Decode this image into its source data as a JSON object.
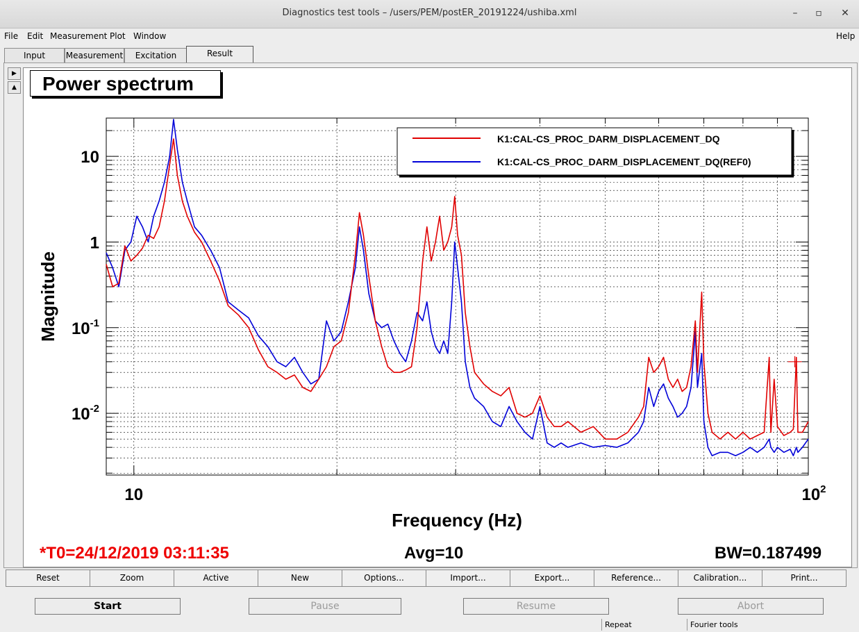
{
  "window": {
    "title": "Diagnostics test tools – /users/PEM/postER_20191224/ushiba.xml"
  },
  "menu": {
    "file": "File",
    "edit": "Edit",
    "measurement": "Measurement",
    "plot": "Plot",
    "window": "Window",
    "help": "Help"
  },
  "tabs": [
    "Input",
    "Measurement",
    "Excitation",
    "Result"
  ],
  "active_tab": "Result",
  "plot": {
    "title": "Power spectrum",
    "status_left": "*T0=24/12/2019 03:11:35",
    "status_mid": "Avg=10",
    "status_right": "BW=0.187499"
  },
  "chart_data": {
    "type": "line",
    "xlabel": "Frequency (Hz)",
    "ylabel": "Magnitude",
    "xscale": "log",
    "yscale": "log",
    "xlim": [
      9.1,
      100
    ],
    "ylim": [
      0.0019,
      28
    ],
    "x_tick_labels": [
      "10",
      "10^2"
    ],
    "y_tick_labels": [
      "10^-2",
      "10^-1",
      "1",
      "10"
    ],
    "grid": true,
    "legend_position": "top-right",
    "legend": [
      {
        "name": "K1:CAL-CS_PROC_DARM_DISPLACEMENT_DQ",
        "color": "#e00000"
      },
      {
        "name": "K1:CAL-CS_PROC_DARM_DISPLACEMENT_DQ(REF0)",
        "color": "#0000d8"
      }
    ],
    "series": [
      {
        "name": "K1:CAL-CS_PROC_DARM_DISPLACEMENT_DQ",
        "color": "#e00000",
        "points": [
          [
            9.1,
            0.55
          ],
          [
            9.3,
            0.3
          ],
          [
            9.5,
            0.33
          ],
          [
            9.7,
            0.9
          ],
          [
            9.9,
            0.6
          ],
          [
            10.1,
            0.7
          ],
          [
            10.3,
            0.85
          ],
          [
            10.5,
            1.2
          ],
          [
            10.7,
            1.1
          ],
          [
            10.9,
            1.5
          ],
          [
            11.1,
            3.0
          ],
          [
            11.3,
            8.0
          ],
          [
            11.45,
            16.0
          ],
          [
            11.6,
            6.0
          ],
          [
            11.8,
            3.0
          ],
          [
            12.0,
            2.0
          ],
          [
            12.3,
            1.3
          ],
          [
            12.6,
            1.0
          ],
          [
            13.0,
            0.6
          ],
          [
            13.4,
            0.35
          ],
          [
            13.8,
            0.18
          ],
          [
            14.3,
            0.14
          ],
          [
            14.8,
            0.1
          ],
          [
            15.3,
            0.055
          ],
          [
            15.8,
            0.035
          ],
          [
            16.3,
            0.03
          ],
          [
            16.8,
            0.025
          ],
          [
            17.3,
            0.028
          ],
          [
            17.8,
            0.02
          ],
          [
            18.3,
            0.018
          ],
          [
            18.8,
            0.025
          ],
          [
            19.3,
            0.035
          ],
          [
            19.8,
            0.06
          ],
          [
            20.3,
            0.07
          ],
          [
            20.8,
            0.15
          ],
          [
            21.3,
            0.7
          ],
          [
            21.6,
            2.2
          ],
          [
            21.9,
            1.2
          ],
          [
            22.3,
            0.4
          ],
          [
            22.8,
            0.12
          ],
          [
            23.3,
            0.06
          ],
          [
            23.8,
            0.035
          ],
          [
            24.3,
            0.03
          ],
          [
            24.8,
            0.03
          ],
          [
            25.3,
            0.032
          ],
          [
            25.8,
            0.035
          ],
          [
            26.3,
            0.1
          ],
          [
            26.8,
            0.6
          ],
          [
            27.2,
            1.5
          ],
          [
            27.6,
            0.6
          ],
          [
            28.0,
            1.0
          ],
          [
            28.4,
            2.0
          ],
          [
            28.8,
            0.8
          ],
          [
            29.2,
            1.0
          ],
          [
            29.6,
            1.5
          ],
          [
            29.9,
            3.4
          ],
          [
            30.2,
            1.2
          ],
          [
            30.6,
            0.7
          ],
          [
            31.0,
            0.15
          ],
          [
            31.5,
            0.06
          ],
          [
            32.0,
            0.03
          ],
          [
            33.0,
            0.022
          ],
          [
            34.0,
            0.018
          ],
          [
            35.0,
            0.016
          ],
          [
            36.0,
            0.02
          ],
          [
            37.0,
            0.01
          ],
          [
            38.0,
            0.009
          ],
          [
            39.0,
            0.01
          ],
          [
            40.0,
            0.016
          ],
          [
            41.0,
            0.009
          ],
          [
            42.0,
            0.007
          ],
          [
            43.0,
            0.007
          ],
          [
            44.0,
            0.008
          ],
          [
            46.0,
            0.006
          ],
          [
            48.0,
            0.007
          ],
          [
            50.0,
            0.005
          ],
          [
            52.0,
            0.005
          ],
          [
            54.0,
            0.006
          ],
          [
            56.0,
            0.009
          ],
          [
            57.0,
            0.012
          ],
          [
            58.0,
            0.045
          ],
          [
            59.0,
            0.03
          ],
          [
            60.0,
            0.035
          ],
          [
            61.0,
            0.045
          ],
          [
            62.0,
            0.025
          ],
          [
            63.0,
            0.02
          ],
          [
            64.0,
            0.025
          ],
          [
            65.0,
            0.018
          ],
          [
            66.0,
            0.02
          ],
          [
            67.0,
            0.035
          ],
          [
            68.0,
            0.12
          ],
          [
            68.5,
            0.03
          ],
          [
            69.5,
            0.26
          ],
          [
            70.0,
            0.04
          ],
          [
            71.0,
            0.01
          ],
          [
            72.0,
            0.006
          ],
          [
            74.0,
            0.005
          ],
          [
            76.0,
            0.006
          ],
          [
            78.0,
            0.005
          ],
          [
            80.0,
            0.006
          ],
          [
            82.0,
            0.005
          ],
          [
            84.0,
            0.0055
          ],
          [
            86.0,
            0.006
          ],
          [
            87.5,
            0.045
          ],
          [
            88.0,
            0.006
          ],
          [
            89.0,
            0.025
          ],
          [
            90.0,
            0.007
          ],
          [
            92.0,
            0.0055
          ],
          [
            94.0,
            0.006
          ],
          [
            95.0,
            0.0065
          ],
          [
            96.0,
            0.045
          ],
          [
            96.5,
            0.006
          ],
          [
            98.0,
            0.006
          ],
          [
            100.0,
            0.008
          ]
        ]
      },
      {
        "name": "K1:CAL-CS_PROC_DARM_DISPLACEMENT_DQ(REF0)",
        "color": "#0000d8",
        "points": [
          [
            9.1,
            0.75
          ],
          [
            9.3,
            0.5
          ],
          [
            9.5,
            0.3
          ],
          [
            9.7,
            0.8
          ],
          [
            9.9,
            1.0
          ],
          [
            10.1,
            2.0
          ],
          [
            10.3,
            1.5
          ],
          [
            10.5,
            1.0
          ],
          [
            10.7,
            2.0
          ],
          [
            10.9,
            3.0
          ],
          [
            11.1,
            5.0
          ],
          [
            11.3,
            10.0
          ],
          [
            11.45,
            27.0
          ],
          [
            11.6,
            12.0
          ],
          [
            11.8,
            5.0
          ],
          [
            12.0,
            3.0
          ],
          [
            12.3,
            1.5
          ],
          [
            12.6,
            1.2
          ],
          [
            13.0,
            0.8
          ],
          [
            13.4,
            0.5
          ],
          [
            13.8,
            0.2
          ],
          [
            14.3,
            0.16
          ],
          [
            14.8,
            0.13
          ],
          [
            15.3,
            0.08
          ],
          [
            15.8,
            0.06
          ],
          [
            16.3,
            0.04
          ],
          [
            16.8,
            0.035
          ],
          [
            17.3,
            0.045
          ],
          [
            17.8,
            0.03
          ],
          [
            18.3,
            0.022
          ],
          [
            18.8,
            0.025
          ],
          [
            19.3,
            0.12
          ],
          [
            19.8,
            0.07
          ],
          [
            20.3,
            0.09
          ],
          [
            20.8,
            0.2
          ],
          [
            21.3,
            0.5
          ],
          [
            21.6,
            1.5
          ],
          [
            21.9,
            0.8
          ],
          [
            22.3,
            0.25
          ],
          [
            22.8,
            0.12
          ],
          [
            23.3,
            0.1
          ],
          [
            23.8,
            0.11
          ],
          [
            24.3,
            0.07
          ],
          [
            24.8,
            0.05
          ],
          [
            25.3,
            0.04
          ],
          [
            25.8,
            0.07
          ],
          [
            26.3,
            0.15
          ],
          [
            26.8,
            0.12
          ],
          [
            27.2,
            0.2
          ],
          [
            27.6,
            0.09
          ],
          [
            28.0,
            0.06
          ],
          [
            28.4,
            0.05
          ],
          [
            28.8,
            0.07
          ],
          [
            29.2,
            0.05
          ],
          [
            29.6,
            0.2
          ],
          [
            29.9,
            1.0
          ],
          [
            30.2,
            0.5
          ],
          [
            30.6,
            0.2
          ],
          [
            31.0,
            0.04
          ],
          [
            31.5,
            0.02
          ],
          [
            32.0,
            0.015
          ],
          [
            33.0,
            0.012
          ],
          [
            34.0,
            0.008
          ],
          [
            35.0,
            0.007
          ],
          [
            36.0,
            0.012
          ],
          [
            37.0,
            0.008
          ],
          [
            38.0,
            0.006
          ],
          [
            39.0,
            0.005
          ],
          [
            40.0,
            0.012
          ],
          [
            41.0,
            0.0045
          ],
          [
            42.0,
            0.004
          ],
          [
            43.0,
            0.0045
          ],
          [
            44.0,
            0.004
          ],
          [
            46.0,
            0.0045
          ],
          [
            48.0,
            0.004
          ],
          [
            50.0,
            0.0042
          ],
          [
            52.0,
            0.004
          ],
          [
            54.0,
            0.0045
          ],
          [
            56.0,
            0.006
          ],
          [
            57.0,
            0.008
          ],
          [
            58.0,
            0.02
          ],
          [
            59.0,
            0.012
          ],
          [
            60.0,
            0.018
          ],
          [
            61.0,
            0.022
          ],
          [
            62.0,
            0.015
          ],
          [
            63.0,
            0.012
          ],
          [
            64.0,
            0.009
          ],
          [
            65.0,
            0.01
          ],
          [
            66.0,
            0.012
          ],
          [
            67.0,
            0.02
          ],
          [
            68.0,
            0.09
          ],
          [
            68.5,
            0.02
          ],
          [
            69.5,
            0.05
          ],
          [
            70.0,
            0.008
          ],
          [
            71.0,
            0.004
          ],
          [
            72.0,
            0.0032
          ],
          [
            74.0,
            0.0035
          ],
          [
            76.0,
            0.0035
          ],
          [
            78.0,
            0.0032
          ],
          [
            80.0,
            0.0035
          ],
          [
            82.0,
            0.004
          ],
          [
            84.0,
            0.0035
          ],
          [
            86.0,
            0.004
          ],
          [
            87.5,
            0.005
          ],
          [
            88.0,
            0.004
          ],
          [
            89.0,
            0.0035
          ],
          [
            90.0,
            0.004
          ],
          [
            92.0,
            0.0035
          ],
          [
            94.0,
            0.0038
          ],
          [
            95.0,
            0.0032
          ],
          [
            96.0,
            0.004
          ],
          [
            96.5,
            0.0035
          ],
          [
            98.0,
            0.004
          ],
          [
            100.0,
            0.005
          ]
        ]
      }
    ],
    "cursor_marker": {
      "x": 95.5,
      "y": 0.04,
      "color": "#e00000"
    }
  },
  "commands": [
    "Reset",
    "Zoom",
    "Active",
    "New",
    "Options...",
    "Import...",
    "Export...",
    "Reference...",
    "Calibration...",
    "Print..."
  ],
  "controls": {
    "start": "Start",
    "pause": "Pause",
    "resume": "Resume",
    "abort": "Abort"
  },
  "statusbar": {
    "repeat": "Repeat",
    "fourier": "Fourier tools"
  }
}
